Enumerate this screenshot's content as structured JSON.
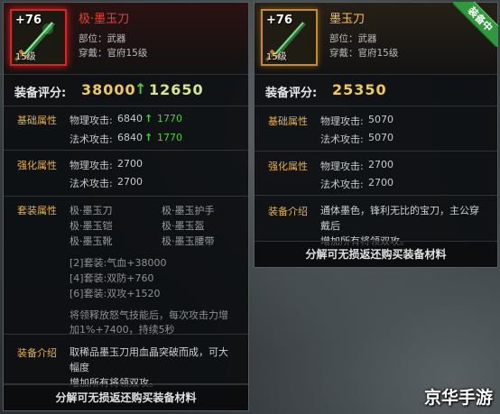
{
  "left": {
    "plus": "+76",
    "level_badge": "15级",
    "name": "极·墨玉刀",
    "slot": "部位：武器",
    "requirement": "穿戴：官府15级",
    "score_label": "装备评分:",
    "score": "38000",
    "score_increase": "12650",
    "base": {
      "title": "基础属性",
      "rows": [
        {
          "k": "物理攻击:",
          "v": "6840",
          "d": "1770"
        },
        {
          "k": "法术攻击:",
          "v": "6840",
          "d": "1770"
        }
      ]
    },
    "enhance": {
      "title": "强化属性",
      "rows": [
        {
          "k": "物理攻击:",
          "v": "2700"
        },
        {
          "k": "法术攻击:",
          "v": "2700"
        }
      ]
    },
    "set": {
      "title": "套装属性",
      "items": [
        "极·墨玉刀",
        "极·墨玉护手",
        "极·墨玉铠",
        "极·墨玉盔",
        "极·墨玉靴",
        "极·墨玉腰带"
      ],
      "bonuses": [
        "[2]套装:气血+38000",
        "[4]套装:双防+760",
        "[6]套装:双攻+1520"
      ],
      "effect_line1": "将领释放怒气技能后，每次攻击力增",
      "effect_line2": "加1%+7400，持续5秒"
    },
    "intro": {
      "title": "装备介绍",
      "line1": "取稀品墨玉刀用血晶突破而成，可大幅度",
      "line2": "增加所有将领双攻。"
    },
    "footer": "分解可无损返还购买装备材料"
  },
  "right": {
    "plus": "+76",
    "level_badge": "15级",
    "ribbon": "装备中",
    "name": "墨玉刀",
    "slot": "部位：武器",
    "requirement": "穿戴：官府15级",
    "score_label": "装备评分:",
    "score": "25350",
    "base": {
      "title": "基础属性",
      "rows": [
        {
          "k": "物理攻击:",
          "v": "5070"
        },
        {
          "k": "法术攻击:",
          "v": "5070"
        }
      ]
    },
    "enhance": {
      "title": "强化属性",
      "rows": [
        {
          "k": "物理攻击:",
          "v": "2700"
        },
        {
          "k": "法术攻击:",
          "v": "2700"
        }
      ]
    },
    "intro": {
      "title": "装备介绍",
      "line1": "通体墨色，锋利无比的宝刀，主公穿戴后",
      "line2": "增加所有将领双攻。"
    },
    "footer": "分解可无损返还购买装备材料"
  },
  "watermark": "京华手游",
  "colors": {
    "gold": "#f0c95a",
    "green": "#47d23a",
    "red": "#e8433a",
    "section": "#e2b150"
  }
}
